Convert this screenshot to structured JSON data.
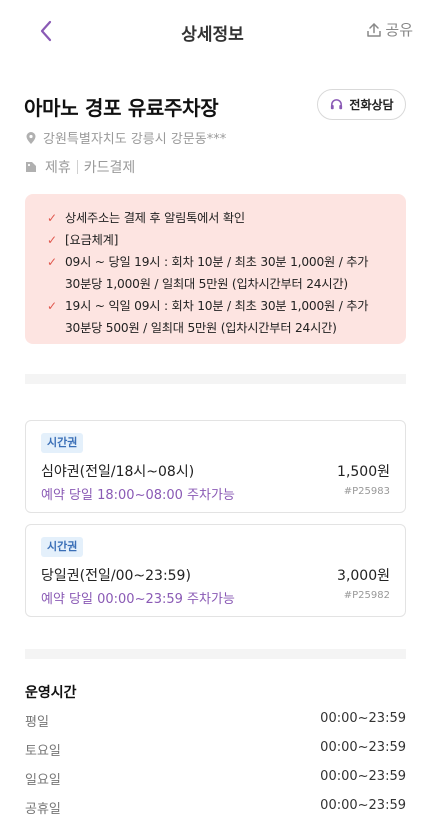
{
  "header": {
    "title": "상세정보",
    "share_label": "공유"
  },
  "lot": {
    "name": "아마노 경포 유료주차장",
    "call_label": "전화상담",
    "address": "강원특별자치도 강릉시 강문동***",
    "tags": [
      "제휴",
      "카드결제"
    ]
  },
  "notice": {
    "items": [
      "상세주소는 결제 후 알림톡에서 확인",
      "[요금체계]",
      "09시 ~ 당일 19시 : 회차 10분 / 최초 30분 1,000원 / 추가 30분당 1,000원 / 일최대 5만원 (입차시간부터 24시간)",
      "19시 ~ 익일 09시 : 회차 10분 / 최초 30분 1,000원 / 추가 30분당 500원 / 일최대 5만원 (입차시간부터 24시간)"
    ]
  },
  "tickets": [
    {
      "badge": "시간권",
      "name": "심야권(전일/18시~08시)",
      "price": "1,500원",
      "desc": "예약 당일 18:00~08:00 주차가능",
      "code": "#P25983"
    },
    {
      "badge": "시간권",
      "name": "당일권(전일/00~23:59)",
      "price": "3,000원",
      "desc": "예약 당일 00:00~23:59 주차가능",
      "code": "#P25982"
    }
  ],
  "hours": {
    "title": "운영시간",
    "rows": [
      {
        "day": "평일",
        "time": "00:00~23:59"
      },
      {
        "day": "토요일",
        "time": "00:00~23:59"
      },
      {
        "day": "일요일",
        "time": "00:00~23:59"
      },
      {
        "day": "공휴일",
        "time": "00:00~23:59"
      }
    ]
  },
  "colors": {
    "accent": "#8a5ab5",
    "notice_bg": "#fde4e1",
    "check": "#e0584e",
    "badge_bg": "#e4f0fb",
    "badge_text": "#3a6fb7"
  },
  "icons": {
    "back": "chevron-left-icon",
    "share": "share-upload-icon",
    "call": "headset-icon",
    "location": "map-pin-icon",
    "tag": "tag-icon",
    "check": "check-icon"
  }
}
